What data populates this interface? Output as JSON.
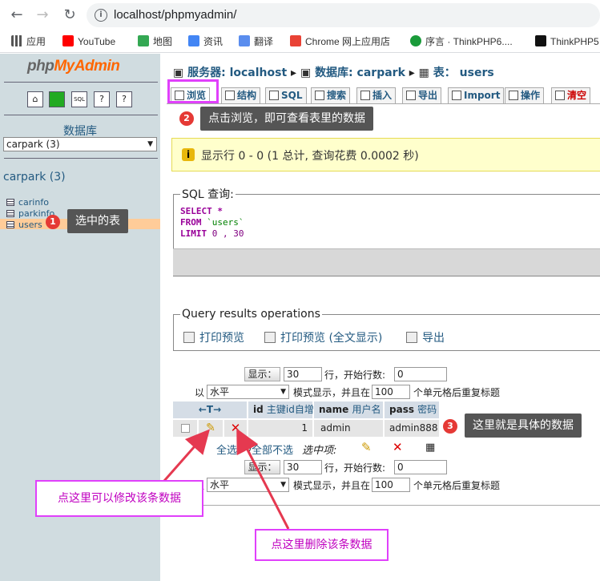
{
  "browser": {
    "url": "localhost/phpmyadmin/",
    "bookmarks": [
      "应用",
      "YouTube",
      "地图",
      "资讯",
      "翻译",
      "Chrome 网上应用店",
      "序言 · ThinkPHP6....",
      "ThinkPHP5"
    ],
    "icons": [
      "back-arrow-icon",
      "forward-arrow-icon",
      "reload-icon",
      "info-icon"
    ]
  },
  "left": {
    "logo_php": "php",
    "logo_myadmin": "MyAdmin",
    "db_label": "数据库",
    "db_select": "carpark (3)",
    "db_name": "carpark (3)",
    "tables": [
      "carinfo",
      "parkinfo",
      "users"
    ]
  },
  "breadcrumb": {
    "server_label": "服务器:",
    "server": "localhost",
    "db_label": "数据库:",
    "db": "carpark",
    "table_label": "表：",
    "table": "users"
  },
  "tabs": [
    "浏览",
    "结构",
    "SQL",
    "搜索",
    "插入",
    "导出",
    "Import",
    "操作",
    "清空"
  ],
  "annotations": {
    "a1": "选中的表",
    "a2": "点击浏览，即可查看表里的数据",
    "a3": "这里就是具体的数据",
    "edit": "点这里可以修改该条数据",
    "delete": "点这里删除该条数据",
    "n1": "1",
    "n2": "2",
    "n3": "3"
  },
  "notice": "显示行 0 - 0 (1 总计, 查询花费 0.0002 秒)",
  "sql": {
    "legend": "SQL 查询:",
    "select": "SELECT",
    "star": "*",
    "from": "FROM",
    "table": "`users`",
    "limit": "LIMIT",
    "lim": "0 , 30"
  },
  "ops": {
    "legend": "Query results operations",
    "print": "打印预览",
    "print_full": "打印预览 (全文显示)",
    "export": "导出"
  },
  "nav": {
    "show_btn": "显示：",
    "rows": "30",
    "rows_label": "行，开始行数:",
    "start": "0",
    "mode_prefix": "以",
    "mode": "水平",
    "mode_label": "模式显示，并且在",
    "repeat": "100",
    "repeat_label": "个单元格后重复标题"
  },
  "table": {
    "arrows": "←T→",
    "headers": [
      {
        "name": "id",
        "comment": "主键id自增"
      },
      {
        "name": "name",
        "comment": "用户名"
      },
      {
        "name": "pass",
        "comment": "密码"
      }
    ],
    "row": {
      "id": "1",
      "name": "admin",
      "pass": "admin888"
    }
  },
  "bulk": {
    "check_all": "全选",
    "uncheck_all": "全部不选",
    "with_selected": "选中项:"
  }
}
